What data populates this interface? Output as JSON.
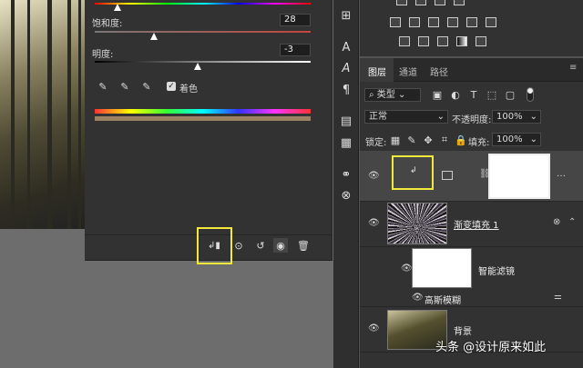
{
  "properties": {
    "saturation_label": "饱和度:",
    "saturation_value": "28",
    "lightness_label": "明度:",
    "lightness_value": "-3",
    "colorize_label": "着色"
  },
  "tabs": [
    "图层",
    "通道",
    "路径"
  ],
  "filter": {
    "kind_label": "类型"
  },
  "blend": {
    "mode": "正常",
    "opacity_label": "不透明度:",
    "opacity_value": "100%"
  },
  "lock": {
    "lock_label": "锁定:",
    "fill_label": "填充:",
    "fill_value": "100%"
  },
  "layers": {
    "gradient_fill_name": "渐变填充 1",
    "smart_filter_label": "智能滤镜",
    "gaussian_blur_label": "高斯模糊",
    "background_name": "背景"
  },
  "watermark": "头条 @设计原来如此",
  "colors": {
    "highlight": "#f2e93d",
    "panel_bg": "#323232",
    "dark_bg": "#2a2a2a"
  }
}
